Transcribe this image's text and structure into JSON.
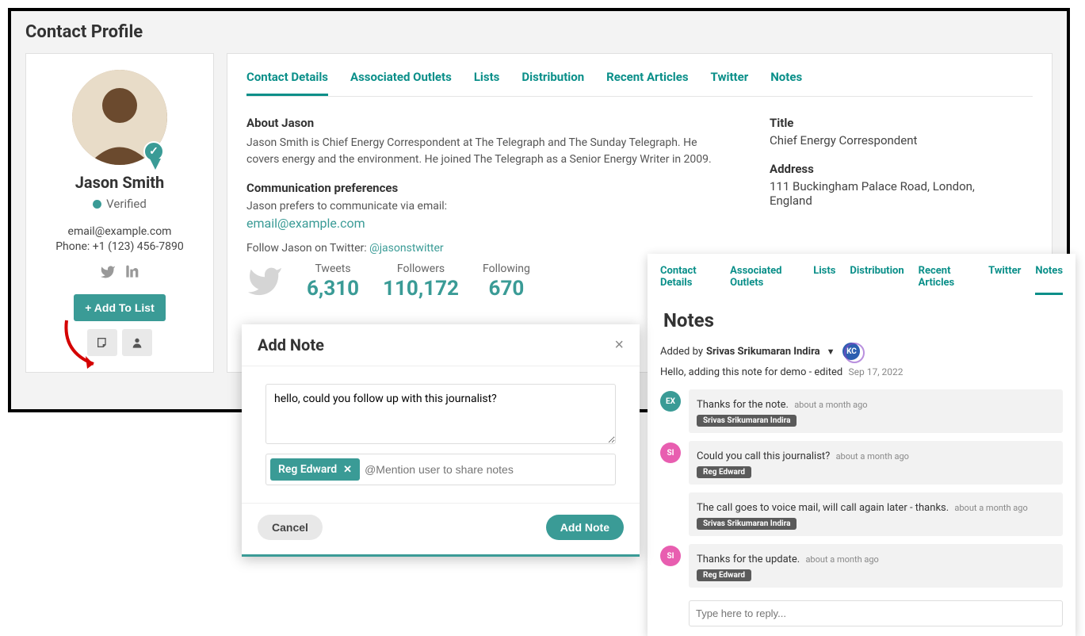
{
  "page_title": "Contact Profile",
  "sidebar": {
    "name": "Jason Smith",
    "verified_label": "Verified",
    "email": "email@example.com",
    "phone_label": "Phone:",
    "phone": "+1 (123) 456-7890",
    "add_list_label": "+ Add To List"
  },
  "tabs": [
    "Contact Details",
    "Associated Outlets",
    "Lists",
    "Distribution",
    "Recent Articles",
    "Twitter",
    "Notes"
  ],
  "active_tab_index": 0,
  "about": {
    "heading": "About Jason",
    "body": "Jason Smith is Chief Energy Correspondent at The Telegraph and The Sunday Telegraph. He covers energy and the environment. He joined The Telegraph as a Senior Energy Writer in 2009.",
    "comm_heading": "Communication preferences",
    "comm_text": "Jason prefers to communicate via email:",
    "comm_email": "email@example.com",
    "twitter_prefix": "Follow Jason on Twitter:",
    "twitter_handle": "@jasonstwitter"
  },
  "stats": {
    "tweets_label": "Tweets",
    "tweets": "6,310",
    "followers_label": "Followers",
    "followers": "110,172",
    "following_label": "Following",
    "following": "670"
  },
  "meta": {
    "title_label": "Title",
    "title": "Chief Energy Correspondent",
    "address_label": "Address",
    "address": "111 Buckingham Palace Road, London, England"
  },
  "modal": {
    "title": "Add Note",
    "textarea_value": "hello, could you follow up with this journalist?",
    "mention_chip": "Reg Edward",
    "mention_placeholder": "@Mention user to share notes",
    "cancel": "Cancel",
    "submit": "Add Note"
  },
  "notes_panel": {
    "tabs": [
      "Contact Details",
      "Associated Outlets",
      "Lists",
      "Distribution",
      "Recent Articles",
      "Twitter",
      "Notes"
    ],
    "active_tab_index": 6,
    "title": "Notes",
    "added_by_prefix": "Added by",
    "added_by_name": "Srivas Srikumaran Indira",
    "badge": "KC",
    "summary_text": "Hello, adding this note for demo - edited",
    "summary_date": "Sep 17, 2022",
    "comments": [
      {
        "initials": "EX",
        "av_class": "av-green",
        "text": "Thanks for the note.",
        "time": "about a month ago",
        "author": "Srivas Srikumaran Indira"
      },
      {
        "initials": "SI",
        "av_class": "av-pink",
        "text": "Could you call this journalist?",
        "time": "about a month ago",
        "author": "Reg Edward"
      },
      {
        "initials": "",
        "av_class": "",
        "text": "The call goes to voice mail, will call again later - thanks.",
        "time": "about a month ago",
        "author": "Srivas Srikumaran Indira"
      },
      {
        "initials": "SI",
        "av_class": "av-pink",
        "text": "Thanks for the update.",
        "time": "about a month ago",
        "author": "Reg Edward"
      }
    ],
    "reply_placeholder": "Type here to reply..."
  }
}
